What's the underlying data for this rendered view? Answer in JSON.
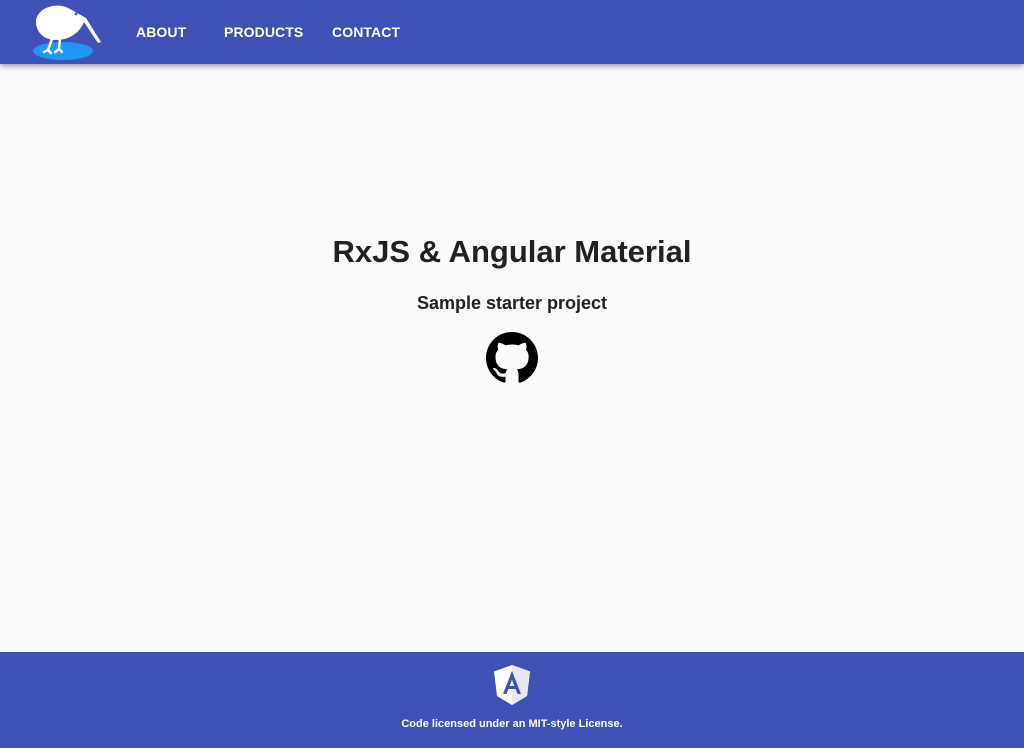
{
  "toolbar": {
    "logo_icon": "kiwi-bird-icon",
    "nav": [
      {
        "label": "ABOUT"
      },
      {
        "label": "PRODUCTS"
      },
      {
        "label": "CONTACT"
      }
    ],
    "color": "#3f51b5"
  },
  "main": {
    "title": "RxJS & Angular Material",
    "subtitle": "Sample starter project",
    "github_icon": "github-icon"
  },
  "footer": {
    "logo_icon": "angular-icon",
    "license_text": "Code licensed under an MIT-style License.",
    "color": "#3f51b5"
  }
}
